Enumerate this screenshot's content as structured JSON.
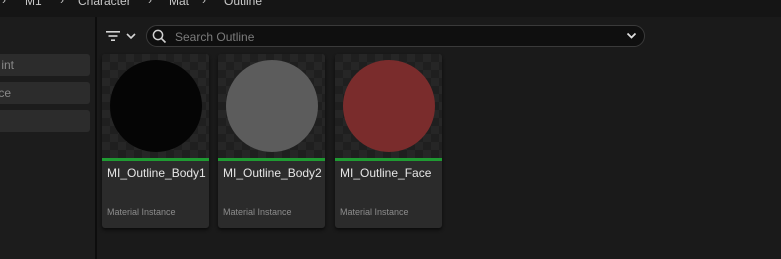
{
  "breadcrumb": {
    "items": [
      "M1",
      "Character",
      "Mat",
      "Outline"
    ]
  },
  "sidebar": {
    "filters": [
      {
        "label": "int"
      },
      {
        "label": "ce"
      },
      {
        "label": ""
      }
    ]
  },
  "toolbar": {
    "filter_icon": "filter-icon",
    "search_placeholder": "Search Outline",
    "search_value": ""
  },
  "assets": [
    {
      "name": "MI_Outline_Body1",
      "type": "Material Instance",
      "color": "#050505"
    },
    {
      "name": "MI_Outline_Body2",
      "type": "Material Instance",
      "color": "#5c5c5c"
    },
    {
      "name": "MI_Outline_Face",
      "type": "Material Instance",
      "color": "#7a2c2c"
    }
  ],
  "colors": {
    "asset_type_material_instance": "#1f9a32",
    "background": "#1a1a1a",
    "tile": "#2b2b2b"
  }
}
